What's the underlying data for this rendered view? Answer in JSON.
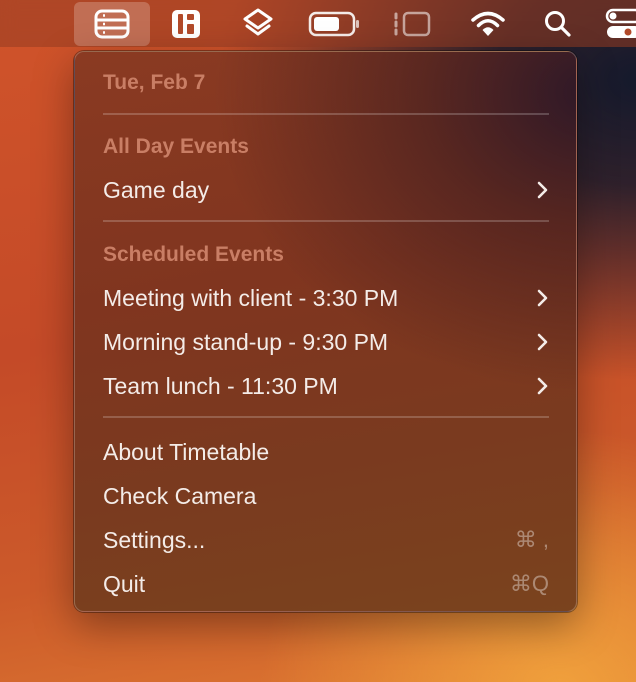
{
  "menubar": {
    "icons": [
      {
        "name": "timetable-list-icon",
        "active": true
      },
      {
        "name": "window-layout-icon",
        "active": false
      },
      {
        "name": "layers-icon",
        "active": false
      },
      {
        "name": "battery-icon",
        "active": false
      },
      {
        "name": "stage-manager-icon",
        "active": false
      },
      {
        "name": "wifi-icon",
        "active": false
      },
      {
        "name": "search-icon",
        "active": false
      },
      {
        "name": "control-center-icon",
        "active": false
      }
    ]
  },
  "menu": {
    "date": "Tue, Feb 7",
    "all_day_header": "All Day Events",
    "all_day_events": [
      {
        "label": "Game day"
      }
    ],
    "scheduled_header": "Scheduled Events",
    "scheduled_events": [
      {
        "label": "Meeting with client - 3:30 PM"
      },
      {
        "label": "Morning stand-up - 9:30 PM"
      },
      {
        "label": "Team lunch - 11:30 PM"
      }
    ],
    "actions": [
      {
        "label": "About Timetable",
        "shortcut": ""
      },
      {
        "label": "Check Camera",
        "shortcut": ""
      },
      {
        "label": "Settings...",
        "shortcut": "⌘ ,"
      },
      {
        "label": "Quit",
        "shortcut": "⌘Q"
      }
    ]
  },
  "colors": {
    "header_text": "#c97e65",
    "item_text": "#f4ece8"
  }
}
